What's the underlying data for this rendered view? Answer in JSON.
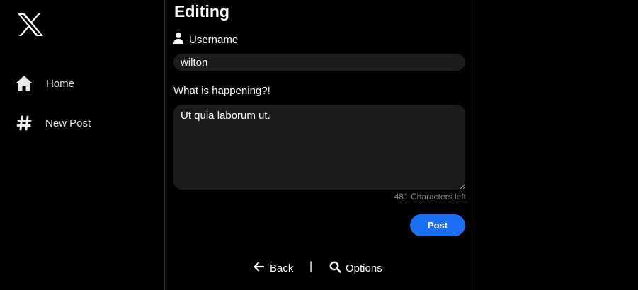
{
  "brand": {
    "logo": "x-logo-icon"
  },
  "nav": {
    "items": [
      {
        "label": "Home",
        "icon": "home-icon"
      },
      {
        "label": "New Post",
        "icon": "hashtag-icon"
      }
    ]
  },
  "editor": {
    "title": "Editing",
    "username_label": "Username",
    "username_value": "wilton",
    "post_label": "What is happening?!",
    "post_value": "Ut quia laborum ut.",
    "chars_left": "481 Characters left",
    "post_button": "Post"
  },
  "footer": {
    "back_label": "Back",
    "separator": "|",
    "options_label": "Options"
  },
  "colors": {
    "background": "#000000",
    "input_bg": "#1b1b1b",
    "accent": "#1d6ff2",
    "muted": "#8b8b8b"
  }
}
